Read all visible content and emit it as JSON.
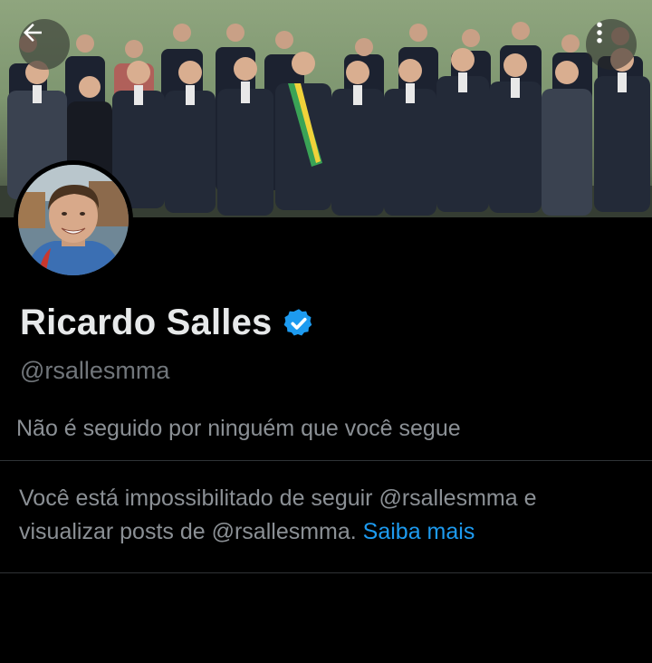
{
  "header": {
    "back_icon": "arrow-left-icon",
    "more_icon": "more-vertical-icon"
  },
  "banner": {
    "description_icon": "group-photo",
    "colors": {
      "backdrop": "#8fa57e",
      "suits": "#1f2530",
      "floor": "#3d463a"
    }
  },
  "profile": {
    "avatar_icon": "avatar-photo",
    "display_name": "Ricardo Salles",
    "verified_icon": "verified-badge-icon",
    "verified_color": "#1d9bf0",
    "handle": "@rsallesmma"
  },
  "followers_note": "Não é seguido por ninguém que você segue",
  "blocked": {
    "message": "Você está impossibilitado de seguir @rsallesmma e visualizar posts de @rsallesmma.",
    "link_label": "Saiba mais",
    "link_color": "#1d9bf0"
  }
}
